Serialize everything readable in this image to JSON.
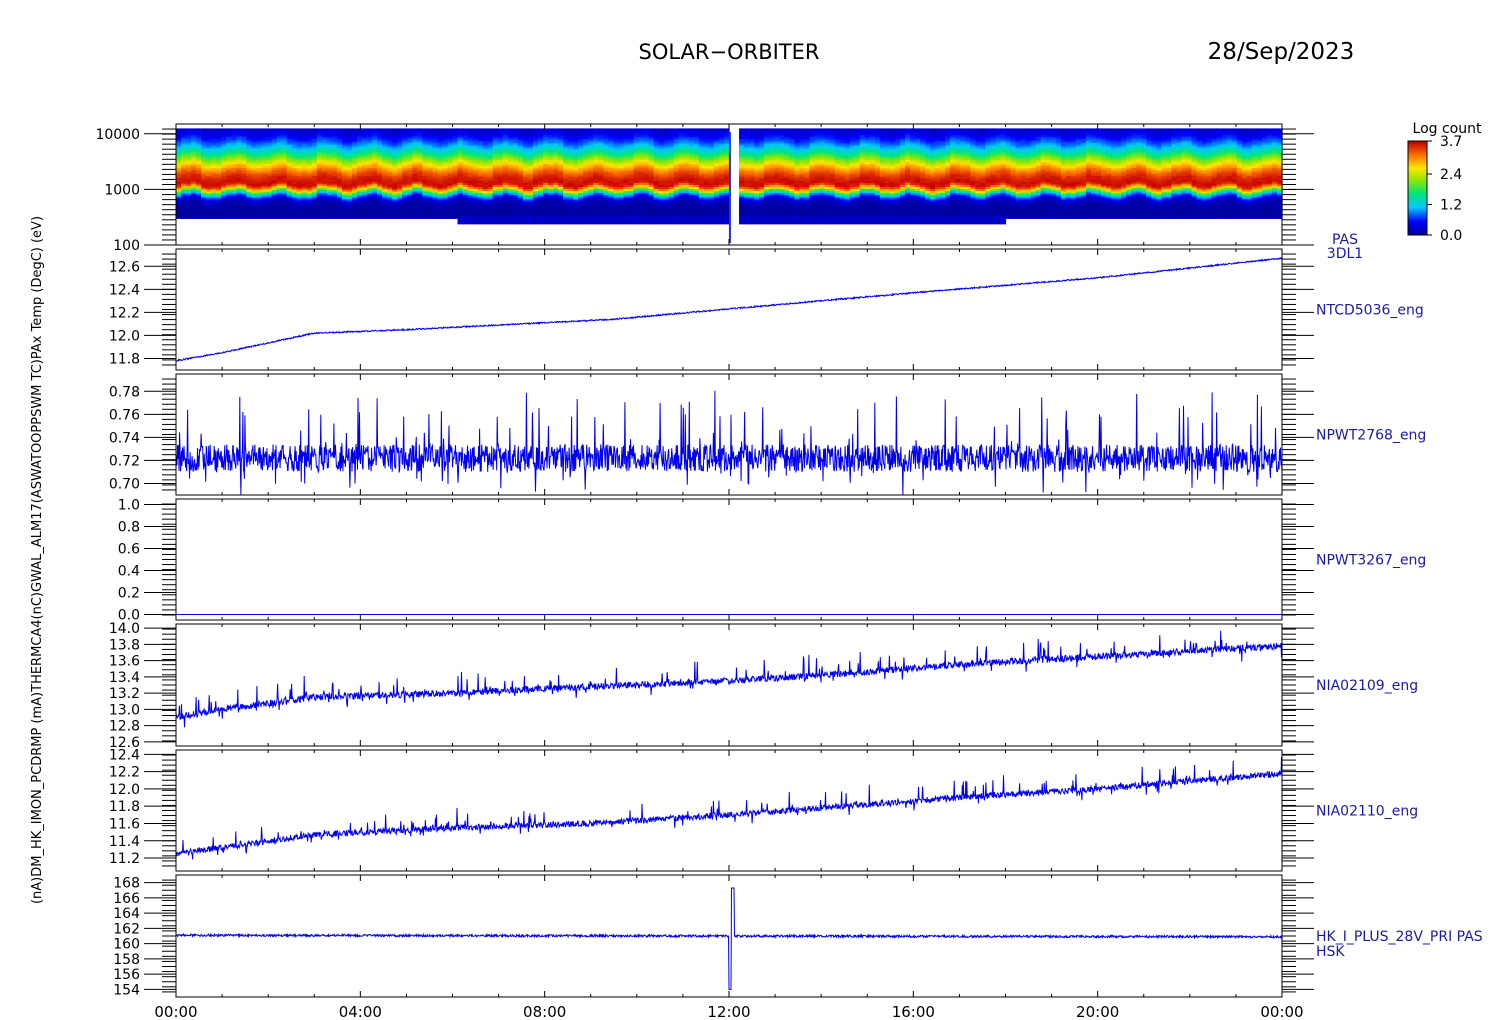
{
  "header": {
    "mission": "SOLAR−ORBITER",
    "date": "28/Sep/2023"
  },
  "colors": {
    "line": "#0000ee",
    "axis": "#000000",
    "label": "#1a1aa8"
  },
  "left_axis_label": "(nA)DM_HK_IMON_PCDRMP (mA)THERMCA4(nC)GWAL_ALM17(ASWATOOPPSWM TC)PAx Temp (DegC) (eV)",
  "x_axis": {
    "tick_labels": [
      "00:00",
      "04:00",
      "08:00",
      "12:00",
      "16:00",
      "20:00",
      "00:00"
    ],
    "range_hours": [
      0,
      24
    ]
  },
  "colorbar": {
    "title": "Log count",
    "ticks": [
      "3.7",
      "2.4",
      "1.2",
      "0.0"
    ],
    "range": [
      0.0,
      3.7
    ]
  },
  "chart_data": [
    {
      "type": "heatmap",
      "name": "",
      "right_label": [
        "PAS",
        "3DL1"
      ],
      "ylabel": "(eV)",
      "yscale": "log",
      "ylim": [
        100,
        15000
      ],
      "y_tick_labels": [
        "10000",
        "1000",
        "100"
      ],
      "y_ticks": [
        10000,
        1000,
        100
      ],
      "peak_energy_ev": 1300,
      "data_gap_hours": [
        12.0,
        12.05
      ]
    },
    {
      "type": "line",
      "right_label": "NTCD5036_eng",
      "ylabel": "PAx Temp (DegC)",
      "ylim": [
        11.7,
        12.75
      ],
      "y_ticks": [
        11.8,
        12.0,
        12.2,
        12.4,
        12.6
      ],
      "y_tick_labels": [
        "11.8",
        "12.0",
        "12.2",
        "12.4",
        "12.6"
      ],
      "trend": {
        "x": [
          0,
          1,
          3,
          5,
          9.5,
          12,
          16,
          20,
          24
        ],
        "y": [
          11.78,
          11.85,
          12.02,
          12.05,
          12.14,
          12.23,
          12.37,
          12.5,
          12.67
        ]
      },
      "noise": 0.006
    },
    {
      "type": "line",
      "right_label": "NPWT2768_eng",
      "ylabel": "ASWATOOPPSWM TC",
      "ylim": [
        0.69,
        0.795
      ],
      "y_ticks": [
        0.7,
        0.72,
        0.74,
        0.76,
        0.78
      ],
      "y_tick_labels": [
        "0.70",
        "0.72",
        "0.74",
        "0.76",
        "0.78"
      ],
      "trend": {
        "x": [
          0,
          24
        ],
        "y": [
          0.722,
          0.722
        ]
      },
      "noise": 0.012,
      "spikes": 0.05
    },
    {
      "type": "line",
      "right_label": "NPWT3267_eng",
      "ylabel": "GWAL_ALM17",
      "ylim": [
        -0.05,
        1.05
      ],
      "y_ticks": [
        0.0,
        0.2,
        0.4,
        0.6,
        0.8,
        1.0
      ],
      "y_tick_labels": [
        "0.0",
        "0.2",
        "0.4",
        "0.6",
        "0.8",
        "1.0"
      ],
      "trend": {
        "x": [
          0,
          24
        ],
        "y": [
          0.0,
          0.0
        ]
      },
      "noise": 0
    },
    {
      "type": "line",
      "right_label": "NIA02109_eng",
      "ylabel": "THERMCA4 (nC)",
      "ylim": [
        12.55,
        14.05
      ],
      "y_ticks": [
        12.6,
        12.8,
        13.0,
        13.2,
        13.4,
        13.6,
        13.8,
        14.0
      ],
      "y_tick_labels": [
        "12.6",
        "12.8",
        "13.0",
        "13.2",
        "13.4",
        "13.6",
        "13.8",
        "14.0"
      ],
      "trend": {
        "x": [
          0,
          1,
          3,
          6,
          9,
          12,
          14,
          17,
          20,
          24
        ],
        "y": [
          12.9,
          13.0,
          13.15,
          13.2,
          13.28,
          13.35,
          13.42,
          13.55,
          13.65,
          13.78
        ]
      },
      "noise": 0.04,
      "spikes": 0.25
    },
    {
      "type": "line",
      "right_label": "NIA02110_eng",
      "ylabel": "DM_HK_IMON_PCDRMP (mA)",
      "ylim": [
        11.05,
        12.45
      ],
      "y_ticks": [
        11.2,
        11.4,
        11.6,
        11.8,
        12.0,
        12.2,
        12.4
      ],
      "y_tick_labels": [
        "11.2",
        "11.4",
        "11.6",
        "11.8",
        "12.0",
        "12.2",
        "12.4"
      ],
      "trend": {
        "x": [
          0,
          1,
          3,
          6,
          9,
          12,
          14,
          17,
          20,
          24
        ],
        "y": [
          11.25,
          11.32,
          11.47,
          11.55,
          11.6,
          11.7,
          11.78,
          11.9,
          12.0,
          12.18
        ]
      },
      "noise": 0.035,
      "spikes": 0.2
    },
    {
      "type": "line",
      "right_label": [
        "HK_I_PLUS_28V_PRI PAS",
        "HSK"
      ],
      "ylabel": "(nA)",
      "ylim": [
        153,
        169
      ],
      "y_ticks": [
        154,
        156,
        158,
        160,
        162,
        164,
        166,
        168
      ],
      "y_tick_labels": [
        "154",
        "156",
        "158",
        "160",
        "162",
        "164",
        "166",
        "168"
      ],
      "trend": {
        "x": [
          0,
          24
        ],
        "y": [
          161.1,
          160.9
        ]
      },
      "noise": 0.15,
      "glitch": {
        "x": 12.05,
        "min": 154.0,
        "max": 167.3
      }
    }
  ]
}
